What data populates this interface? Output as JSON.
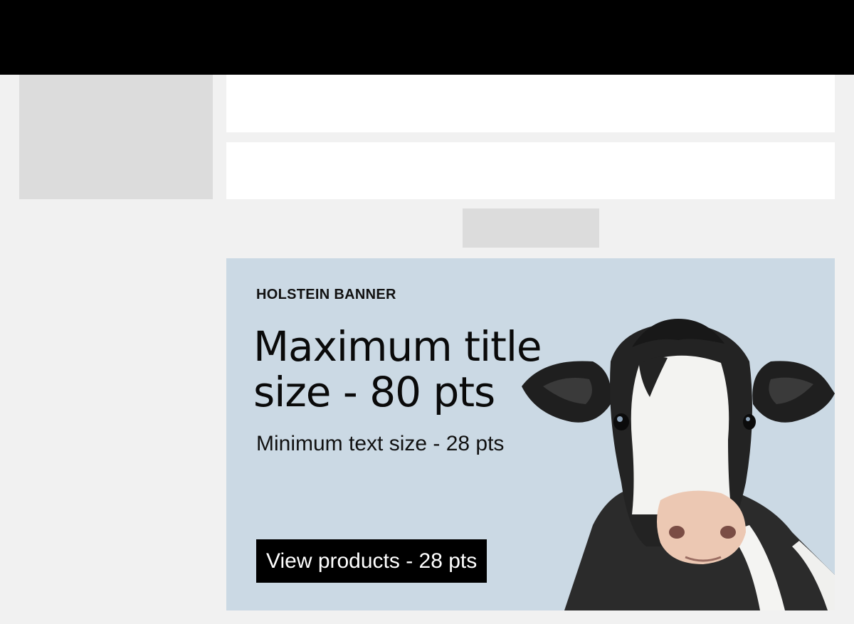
{
  "banner": {
    "eyebrow": "HOLSTEIN BANNER",
    "title": "Maximum title size - 80 pts",
    "subtitle": "Minimum text size - 28 pts",
    "cta_label": "View products - 28 pts",
    "image_icon": "cow-photo"
  },
  "colors": {
    "topbar": "#000000",
    "page_background": "#f1f1f1",
    "placeholder": "#dcdcdc",
    "banner_background": "#cbd9e4",
    "cta_background": "#000000",
    "cta_text": "#ffffff"
  }
}
